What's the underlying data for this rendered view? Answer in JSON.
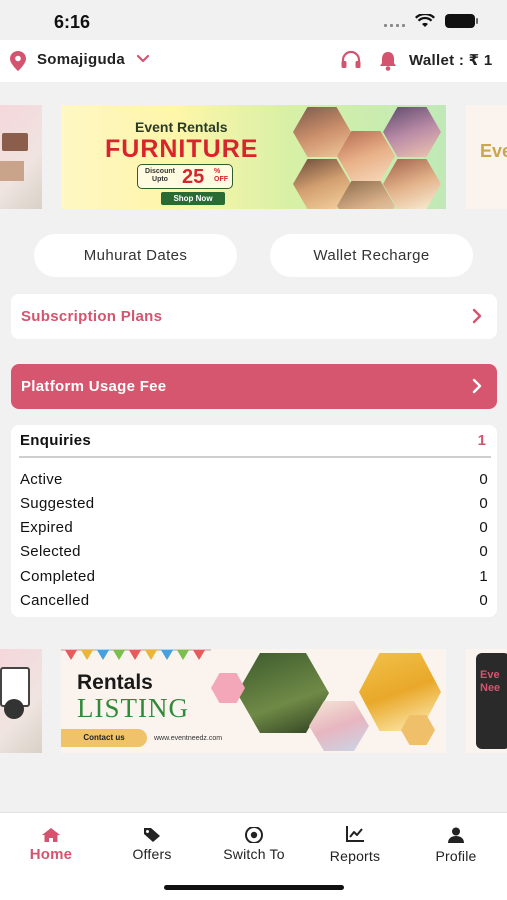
{
  "status_bar": {
    "time": "6:16"
  },
  "header": {
    "location": "Somajiguda",
    "wallet_label": "Wallet : ₹ 1"
  },
  "banner_top": {
    "title": "Event Rentals",
    "headline": "FURNITURE",
    "discount_label": "Discount Upto",
    "discount_value": "25",
    "discount_unit": "%",
    "discount_off": "OFF",
    "cta": "Shop Now",
    "side_right_text": "Eve"
  },
  "quick_actions": {
    "muhurat": "Muhurat Dates",
    "wallet_recharge": "Wallet Recharge"
  },
  "subscription": {
    "label": "Subscription Plans"
  },
  "platform_fee": {
    "label": "Platform Usage Fee"
  },
  "enquiries": {
    "title": "Enquiries",
    "total": "1",
    "rows": [
      {
        "label": "Active",
        "value": "0"
      },
      {
        "label": "Suggested",
        "value": "0"
      },
      {
        "label": "Expired",
        "value": "0"
      },
      {
        "label": "Selected",
        "value": "0"
      },
      {
        "label": "Completed",
        "value": "1"
      },
      {
        "label": "Cancelled",
        "value": "0"
      }
    ]
  },
  "banner_bottom": {
    "line1": "Rentals",
    "line2": "LISTING",
    "cta": "Contact us",
    "url": "www.eventneedz.com",
    "side_right_text": "Eve Nee"
  },
  "tabs": [
    {
      "label": "Home",
      "icon": "home-icon",
      "active": true
    },
    {
      "label": "Offers",
      "icon": "tag-icon",
      "active": false
    },
    {
      "label": "Switch To",
      "icon": "switch-icon",
      "active": false
    },
    {
      "label": "Reports",
      "icon": "chart-icon",
      "active": false
    },
    {
      "label": "Profile",
      "icon": "person-icon",
      "active": false
    }
  ],
  "colors": {
    "accent": "#d4546f",
    "fee_bg": "#d5566e",
    "background": "#f1f1f1"
  }
}
